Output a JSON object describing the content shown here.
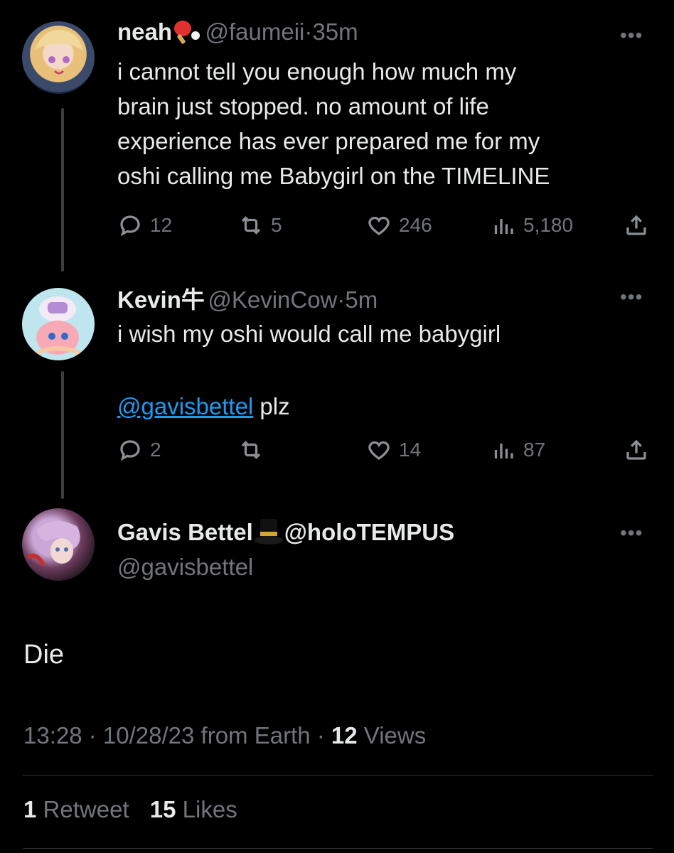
{
  "tweets": [
    {
      "name": "neah",
      "handle": "@faumeii",
      "sep": "·",
      "time": "35m",
      "text": "i cannot tell you enough how much my\nbrain just stopped. no amount of life\nexperience has ever prepared me for my\noshi calling me Babygirl on the TIMELINE",
      "replies": "12",
      "retweets": "5",
      "likes": "246",
      "views": "5,180"
    },
    {
      "name": "Kevin牛",
      "handle": "@KevinCow",
      "sep": "·",
      "time": "5m",
      "text_line1": "i wish my oshi would call me babygirl",
      "mention": "@gavisbettel",
      "text_after_mention": " plz",
      "replies": "2",
      "retweets": "",
      "likes": "14",
      "views": "87"
    }
  ],
  "main": {
    "name": "Gavis Bettel",
    "name_suffix": "@holoTEMPUS",
    "handle": "@gavisbettel",
    "text": "Die",
    "timestamp": "13:28 · 10/28/23 from Earth · ",
    "views_count": "12",
    "views_label": " Views",
    "retweet_count": "1",
    "retweet_label": " Retweet",
    "likes_count": "15",
    "likes_label": " Likes"
  },
  "icons": {
    "emoji1": "ping-pong-emoji",
    "emoji2": "top-hat-emoji",
    "more": "more-icon",
    "reply": "reply-icon",
    "retweet": "retweet-icon",
    "like": "heart-icon",
    "views": "views-icon",
    "share": "share-icon"
  },
  "colors": {
    "background": "#000000",
    "text": "#e7e9ea",
    "secondary": "#71767b",
    "link": "#1d9bf0",
    "divider": "#2f3336"
  }
}
